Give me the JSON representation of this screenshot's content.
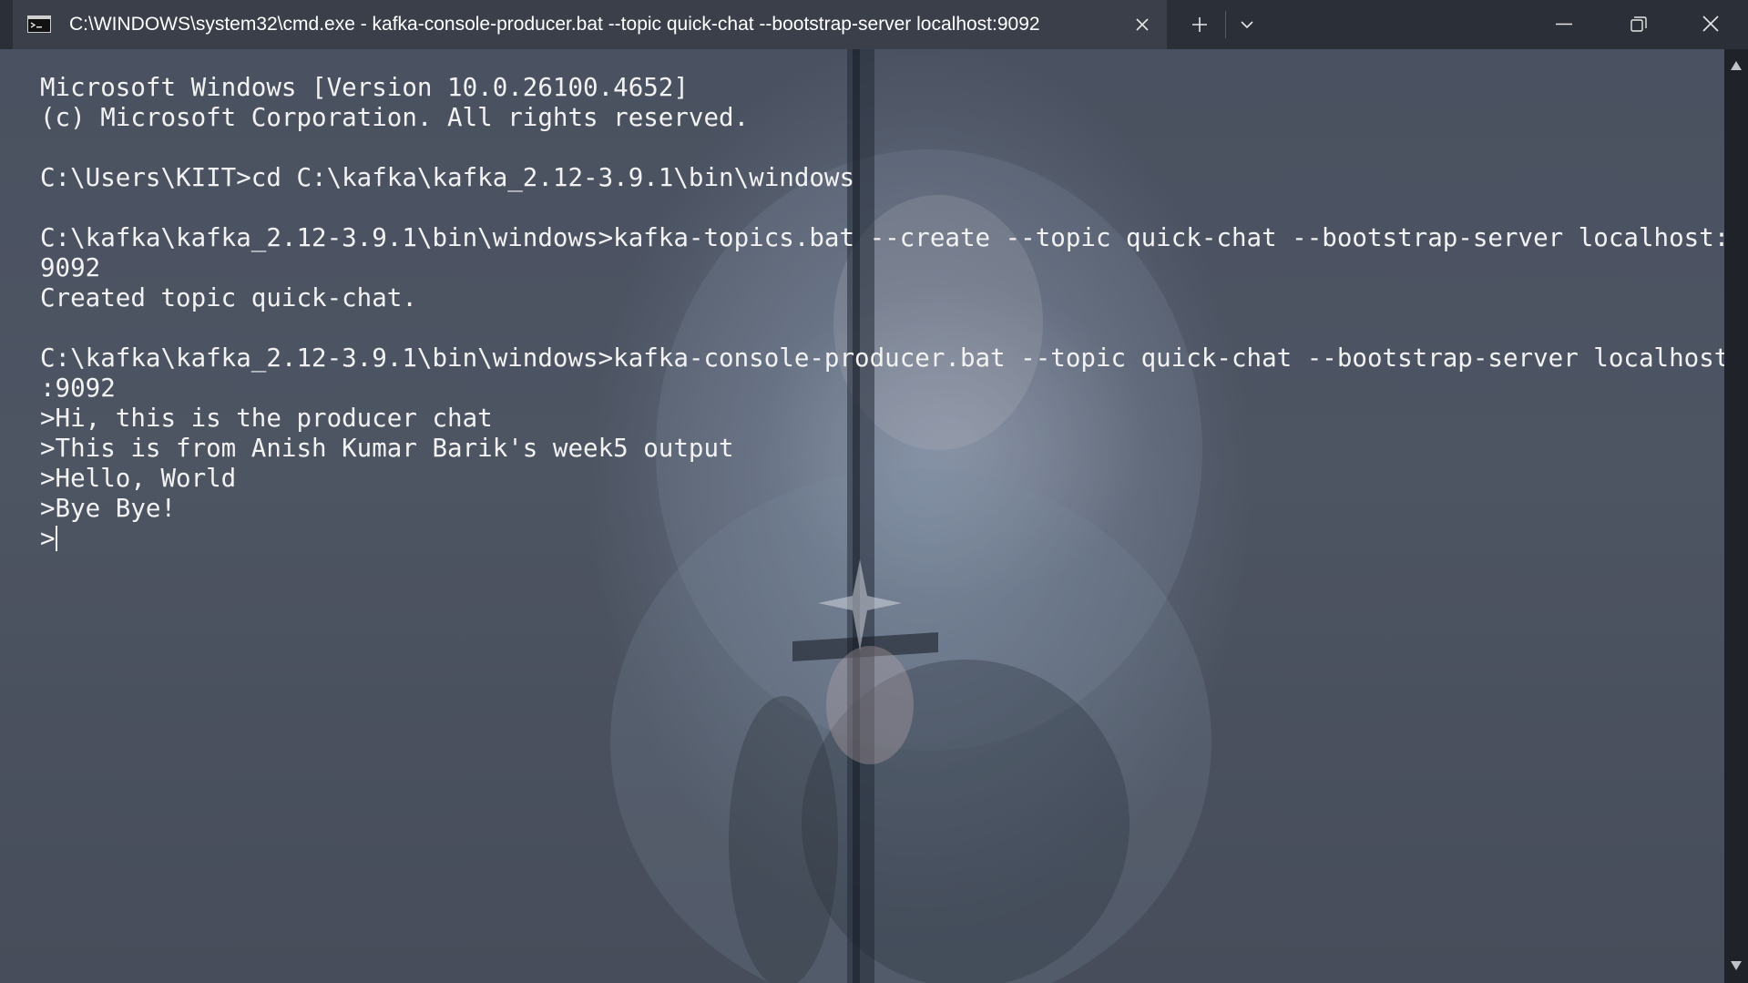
{
  "window": {
    "tab_title": "C:\\WINDOWS\\system32\\cmd.exe - kafka-console-producer.bat  --topic quick-chat --bootstrap-server localhost:9092"
  },
  "icons": {
    "tab": "terminal-icon",
    "tab_close": "close-icon",
    "new_tab": "plus-icon",
    "dropdown": "chevron-down-icon",
    "minimize": "minimize-icon",
    "maximize": "restore-icon",
    "close": "close-icon"
  },
  "terminal": {
    "lines": [
      "Microsoft Windows [Version 10.0.26100.4652]",
      "(c) Microsoft Corporation. All rights reserved.",
      "",
      "C:\\Users\\KIIT>cd C:\\kafka\\kafka_2.12-3.9.1\\bin\\windows",
      "",
      "C:\\kafka\\kafka_2.12-3.9.1\\bin\\windows>kafka-topics.bat --create --topic quick-chat --bootstrap-server localhost:",
      "9092",
      "Created topic quick-chat.",
      "",
      "C:\\kafka\\kafka_2.12-3.9.1\\bin\\windows>kafka-console-producer.bat --topic quick-chat --bootstrap-server localhost",
      ":9092",
      ">Hi, this is the producer chat",
      ">This is from Anish Kumar Barik's week5 output",
      ">Hello, World",
      ">Bye Bye!"
    ],
    "prompt": ">"
  },
  "colors": {
    "titlebar_bg": "#2b2f37",
    "tab_bg": "#3a3f4a",
    "terminal_text": "#f2f2f2"
  }
}
